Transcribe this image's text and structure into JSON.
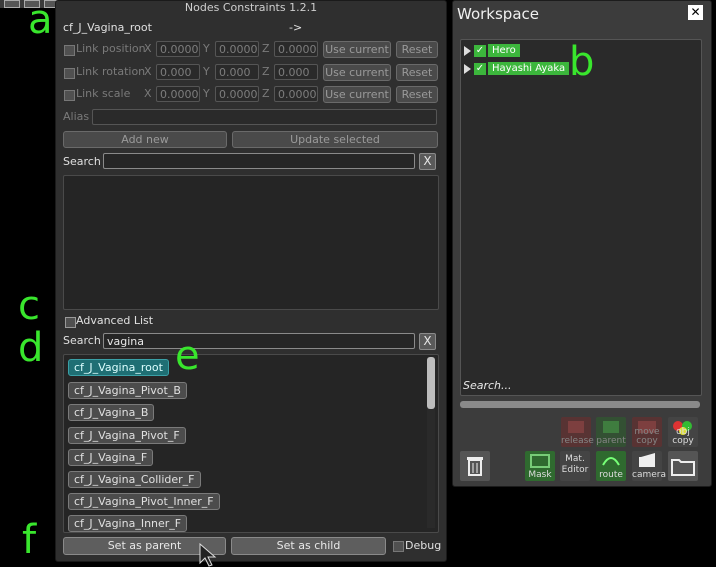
{
  "markers": {
    "a": "a",
    "b": "b",
    "c": "c",
    "d": "d",
    "e": "e",
    "f": "f"
  },
  "nodes_window": {
    "title": "Nodes Constraints 1.2.1",
    "selected_node": "cf_J_Vagina_root",
    "arrow": "->",
    "link_position": {
      "label": "Link position",
      "x": "0.0000",
      "y": "0.0000",
      "z": "0.0000",
      "use_current": "Use current",
      "reset": "Reset"
    },
    "link_rotation": {
      "label": "Link rotation",
      "x": "0.000",
      "y": "0.000",
      "z": "0.000",
      "use_current": "Use current",
      "reset": "Reset"
    },
    "link_scale": {
      "label": "Link scale",
      "x": "0.0000",
      "y": "0.0000",
      "z": "0.0000",
      "use_current": "Use current",
      "reset": "Reset"
    },
    "axis_labels": {
      "x": "X",
      "y": "Y",
      "z": "Z"
    },
    "alias_label": "Alias",
    "add_new": "Add new",
    "update_selected": "Update selected",
    "search_label": "Search",
    "search_clear": "X",
    "advanced_list": "Advanced List",
    "search2_label": "Search",
    "search2_value": "vagina",
    "search2_clear": "X",
    "node_list": [
      "cf_J_Vagina_root",
      "cf_J_Vagina_Pivot_B",
      "cf_J_Vagina_B",
      "cf_J_Vagina_Pivot_F",
      "cf_J_Vagina_F",
      "cf_J_Vagina_Collider_F",
      "cf_J_Vagina_Pivot_Inner_F",
      "cf_J_Vagina_Inner_F"
    ],
    "set_as_parent": "Set as parent",
    "set_as_child": "Set as child",
    "debug": "Debug"
  },
  "workspace": {
    "title": "Workspace",
    "close": "✕",
    "items": [
      "Hero",
      "Hayashi Ayaka"
    ],
    "search_placeholder": "Search...",
    "tools": {
      "release": "release",
      "parent": "parent",
      "move_copy": "move copy",
      "obj_copy": "obj copy",
      "mask": "Mask",
      "mat_editor": "Mat. Editor",
      "route": "route",
      "camera": "camera"
    }
  },
  "colors": {
    "marker": "#39e62d",
    "selected_node": "#1f6f74",
    "workspace_check": "#3cb63c"
  }
}
